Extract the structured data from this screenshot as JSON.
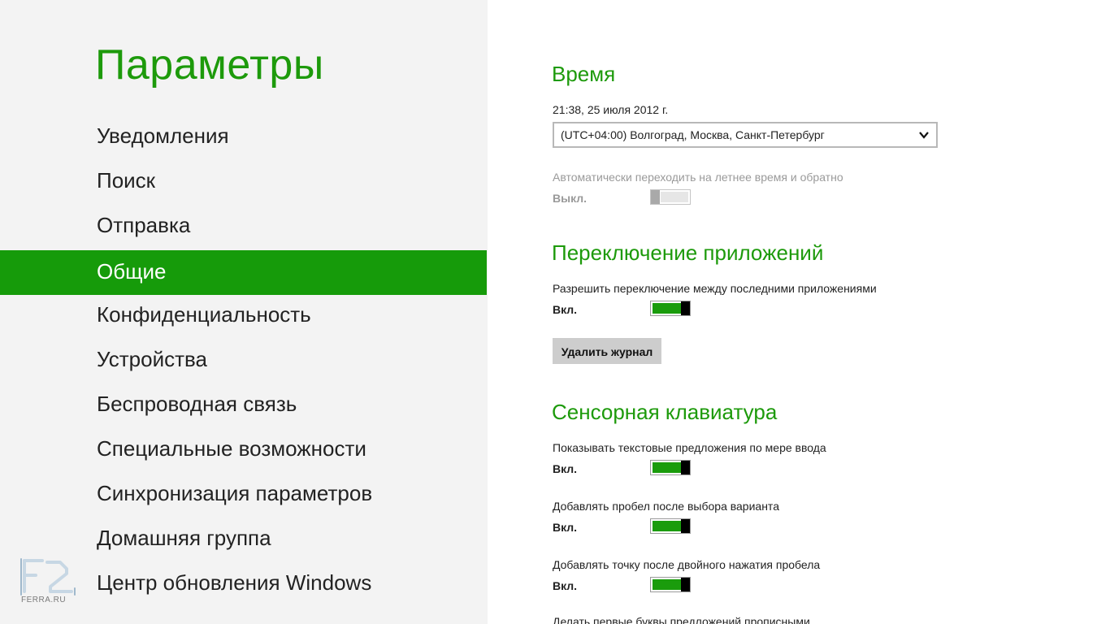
{
  "left": {
    "title": "Параметры",
    "nav": [
      {
        "label": "Уведомления",
        "active": false
      },
      {
        "label": "Поиск",
        "active": false
      },
      {
        "label": "Отправка",
        "active": false
      },
      {
        "label": "Общие",
        "active": true
      },
      {
        "label": "Конфиденциальность",
        "active": false
      },
      {
        "label": "Устройства",
        "active": false
      },
      {
        "label": "Беспроводная связь",
        "active": false
      },
      {
        "label": "Специальные возможности",
        "active": false
      },
      {
        "label": "Синхронизация параметров",
        "active": false
      },
      {
        "label": "Домашняя группа",
        "active": false
      },
      {
        "label": "Центр обновления Windows",
        "active": false
      }
    ],
    "watermark": "FERRA.RU"
  },
  "time": {
    "title": "Время",
    "datetime": "21:38, 25 июля 2012 г.",
    "timezone": "(UTC+04:00) Волгоград, Москва, Санкт-Петербург",
    "dst_label": "Автоматически переходить на летнее время и обратно",
    "dst_state": "Выкл."
  },
  "app_switching": {
    "title": "Переключение приложений",
    "allow_label": "Разрешить переключение между последними приложениями",
    "allow_state": "Вкл.",
    "clear_button": "Удалить журнал"
  },
  "keyboard": {
    "title": "Сенсорная клавиатура",
    "suggest_label": "Показывать текстовые предложения по мере ввода",
    "suggest_state": "Вкл.",
    "space_label": "Добавлять пробел после выбора варианта",
    "space_state": "Вкл.",
    "period_label": "Добавлять точку после двойного нажатия пробела",
    "period_state": "Вкл.",
    "caps_label": "Делать первые буквы предложений прописными"
  },
  "colors": {
    "accent": "#1d9a0b",
    "nav_active_bg": "#169b0a",
    "left_bg": "#f3f3f3"
  },
  "icons": {
    "timezone_dropdown": "chevron-down-icon",
    "watermark": "ferra-logo-icon"
  }
}
